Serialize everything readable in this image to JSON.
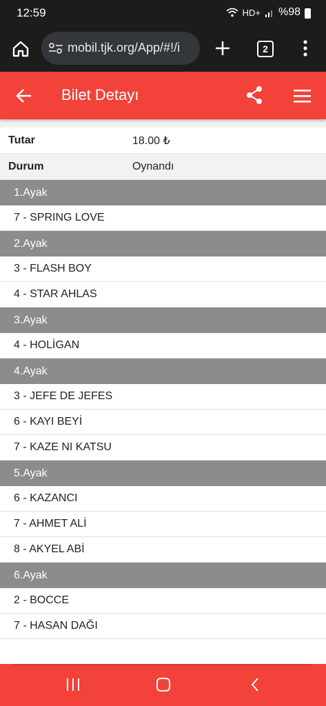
{
  "status_bar": {
    "time": "12:59",
    "battery": "%98",
    "network": "HD+"
  },
  "browser": {
    "url": "mobil.tjk.org/App/#!/i",
    "tab_count": "2"
  },
  "app_bar": {
    "title": "Bilet Detayı"
  },
  "ticket": {
    "rows": [
      {
        "key": "Tutar",
        "value": "18.00 ₺"
      },
      {
        "key": "Durum",
        "value": "Oynandı"
      }
    ]
  },
  "legs": [
    {
      "title": "1.Ayak",
      "horses": [
        "7 - SPRING LOVE"
      ]
    },
    {
      "title": "2.Ayak",
      "horses": [
        "3 - FLASH BOY",
        "4 - STAR AHLAS"
      ]
    },
    {
      "title": "3.Ayak",
      "horses": [
        "4 - HOLİGAN"
      ]
    },
    {
      "title": "4.Ayak",
      "horses": [
        "3 - JEFE DE JEFES",
        "6 - KAYI BEYİ",
        "7 - KAZE NI KATSU"
      ]
    },
    {
      "title": "5.Ayak",
      "horses": [
        "6 - KAZANCI",
        "7 - AHMET ALİ",
        "8 - AKYEL ABİ"
      ]
    },
    {
      "title": "6.Ayak",
      "horses": [
        "2 - BOCCE",
        "7 - HASAN DAĞI"
      ]
    }
  ],
  "colors": {
    "accent": "#f2423a",
    "leg_header": "#8c8c8c",
    "browser_bg": "#1c1c1c"
  },
  "icons": {
    "browser": [
      "home-icon",
      "site-settings-icon",
      "new-tab-icon",
      "tab-switcher-icon",
      "more-options-icon"
    ],
    "app_bar": [
      "back-arrow-icon",
      "share-icon",
      "hamburger-menu-icon"
    ],
    "nav": [
      "recent-apps-icon",
      "home-nav-icon",
      "back-nav-icon"
    ]
  }
}
